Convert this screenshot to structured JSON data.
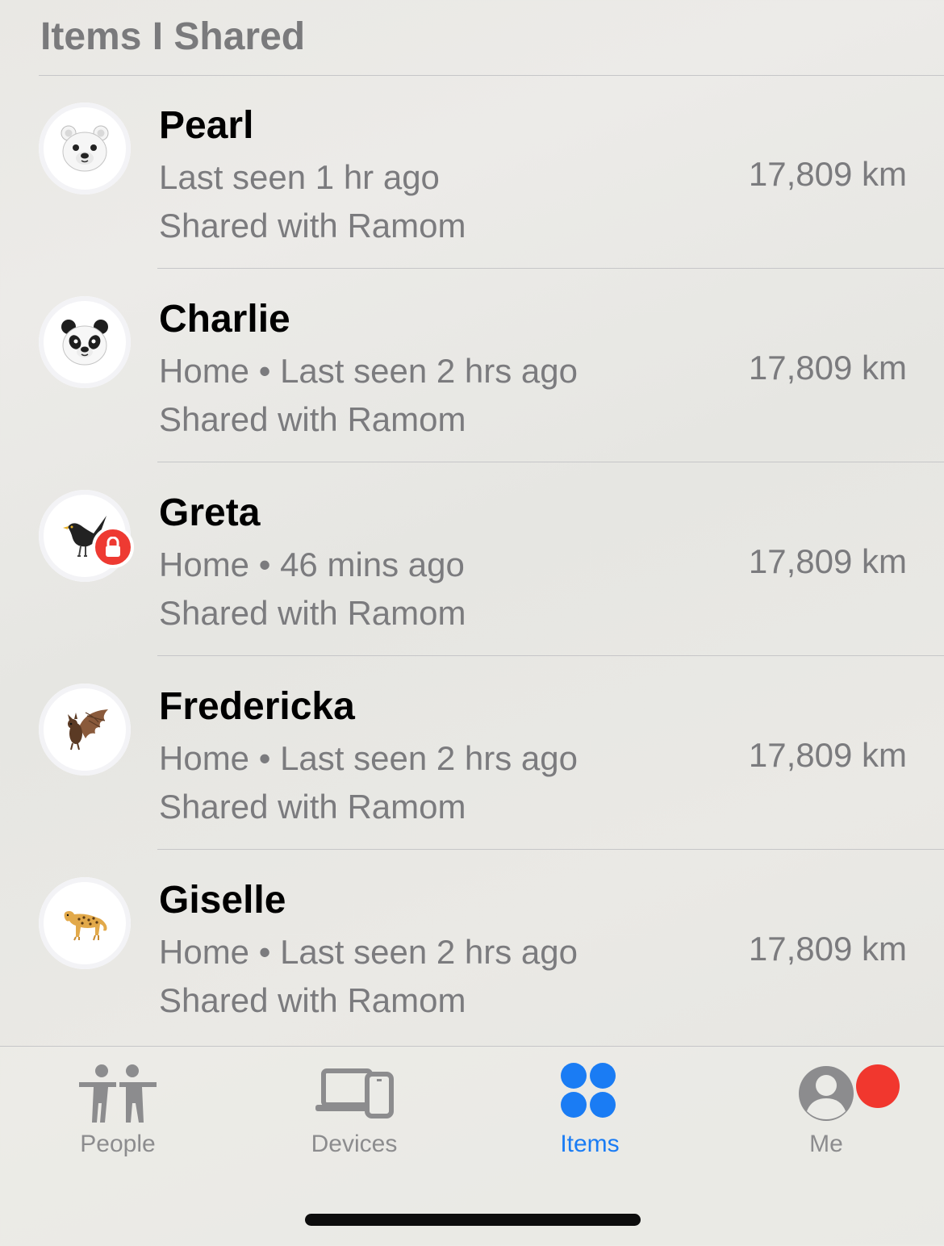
{
  "section_title": "Items I Shared",
  "items": [
    {
      "name": "Pearl",
      "subtitle": "Last seen 1 hr ago",
      "shared": "Shared with Ramom",
      "distance": "17,809 km",
      "icon": "polar-bear-icon",
      "locked": false
    },
    {
      "name": "Charlie",
      "subtitle": "Home • Last seen 2 hrs ago",
      "shared": "Shared with Ramom",
      "distance": "17,809 km",
      "icon": "panda-icon",
      "locked": false
    },
    {
      "name": "Greta",
      "subtitle": "Home • 46 mins ago",
      "shared": "Shared with Ramom",
      "distance": "17,809 km",
      "icon": "blackbird-icon",
      "locked": true
    },
    {
      "name": "Fredericka",
      "subtitle": "Home • Last seen 2 hrs ago",
      "shared": "Shared with Ramom",
      "distance": "17,809 km",
      "icon": "bat-icon",
      "locked": false
    },
    {
      "name": "Giselle",
      "subtitle": "Home • Last seen 2 hrs ago",
      "shared": "Shared with Ramom",
      "distance": "17,809 km",
      "icon": "leopard-icon",
      "locked": false
    }
  ],
  "tabs": [
    {
      "label": "People",
      "icon": "people-icon",
      "active": false
    },
    {
      "label": "Devices",
      "icon": "devices-icon",
      "active": false
    },
    {
      "label": "Items",
      "icon": "items-icon",
      "active": true
    },
    {
      "label": "Me",
      "icon": "me-icon",
      "active": false,
      "badge": true
    }
  ],
  "colors": {
    "accent": "#1a7cf4",
    "badge": "#f1372e",
    "lock_badge": "#ee3a32",
    "secondary_text": "#7b7b7e"
  }
}
